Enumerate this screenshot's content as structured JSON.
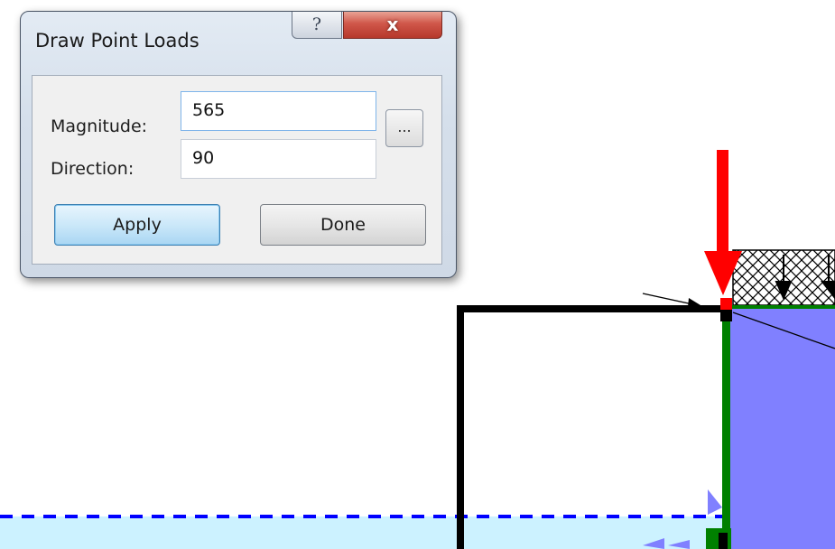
{
  "dialog": {
    "title": "Draw Point Loads",
    "help_glyph": "?",
    "close_glyph": "x",
    "magnitude_label": "Magnitude:",
    "magnitude_value": "565",
    "browse_label": "...",
    "direction_label": "Direction:",
    "direction_value": "90",
    "apply_label": "Apply",
    "done_label": "Done"
  },
  "drawing": {
    "load_arrow_color": "#ff0000",
    "material_fill_color": "#8080ff",
    "water_fill_color": "#ccf2ff",
    "water_line_color": "#0000ff",
    "boundary_color": "#000000",
    "support_color": "#008000"
  }
}
